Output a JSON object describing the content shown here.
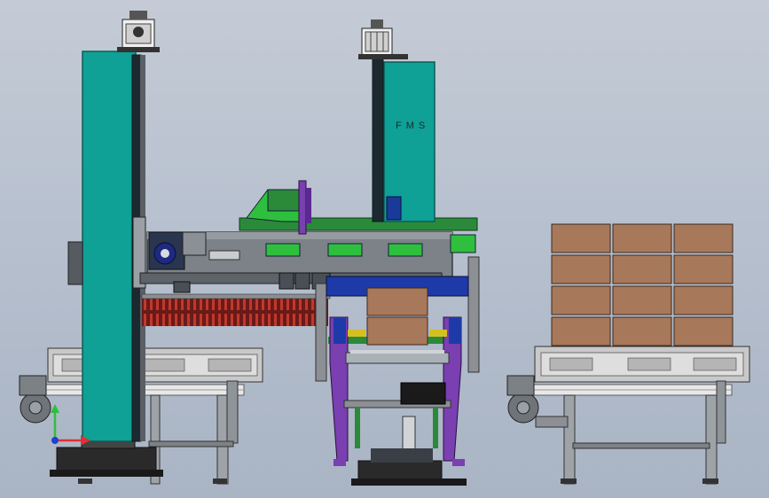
{
  "brand_label": "FMS",
  "colors": {
    "background": "#b8c1cf",
    "teal_column": "#0fa096",
    "box": "#a8785a",
    "frame_grey": "#8c8f94",
    "frame_purple": "#7a3fb0",
    "frame_green": "#2a8a3a",
    "frame_blue": "#1e3aa8",
    "conveyor_red": "#c0392b"
  },
  "pallet_stack": {
    "columns": 3,
    "rows": 4
  },
  "center_load": {
    "columns": 1,
    "rows": 2
  }
}
